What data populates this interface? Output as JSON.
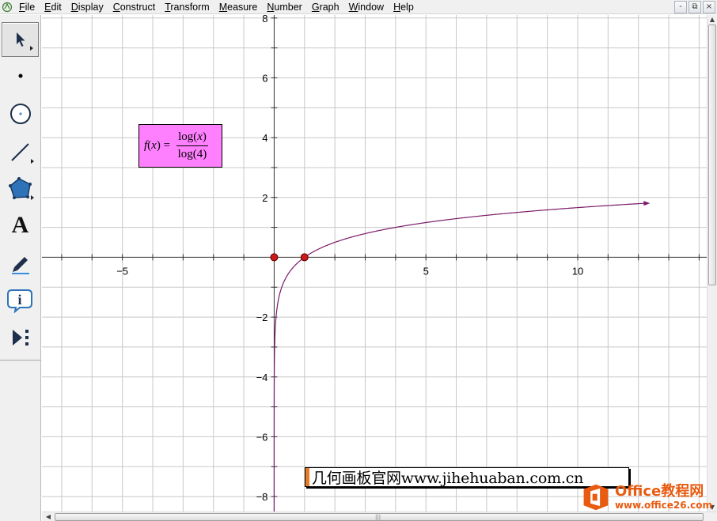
{
  "menubar": {
    "items": [
      {
        "accel": "F",
        "rest": "ile"
      },
      {
        "accel": "E",
        "rest": "dit"
      },
      {
        "accel": "D",
        "rest": "isplay"
      },
      {
        "accel": "C",
        "rest": "onstruct"
      },
      {
        "accel": "T",
        "rest": "ransform"
      },
      {
        "accel": "M",
        "rest": "easure"
      },
      {
        "accel": "N",
        "rest": "umber"
      },
      {
        "accel": "G",
        "rest": "raph"
      },
      {
        "accel": "W",
        "rest": "indow"
      },
      {
        "accel": "H",
        "rest": "elp"
      }
    ],
    "window_controls": [
      "-",
      "⧉",
      "×"
    ]
  },
  "toolbox": {
    "tools": [
      {
        "name": "selection-arrow-tool",
        "icon": "arrow-pointer-icon",
        "selected": true
      },
      {
        "name": "point-tool",
        "icon": "point-icon"
      },
      {
        "name": "compass-tool",
        "icon": "circle-icon"
      },
      {
        "name": "straightedge-tool",
        "icon": "segment-icon"
      },
      {
        "name": "polygon-tool",
        "icon": "polygon-icon"
      },
      {
        "name": "text-tool",
        "icon": "text-a-icon",
        "glyph": "A"
      },
      {
        "name": "marker-tool",
        "icon": "marker-pen-icon"
      },
      {
        "name": "information-tool",
        "icon": "info-icon",
        "glyph": "i"
      },
      {
        "name": "custom-tools",
        "icon": "custom-tools-icon"
      }
    ]
  },
  "graph": {
    "x_ticks": [
      "−5",
      "5",
      "10"
    ],
    "y_ticks": [
      "8",
      "6",
      "4",
      "2",
      "−2",
      "−4",
      "−6",
      "−8"
    ],
    "x_range": [
      -7.65,
      14.25
    ],
    "y_range": [
      -8.5,
      8.1
    ],
    "grid_step": 1,
    "grid": true,
    "curve_color": "#7a1a6a",
    "point_color": "#cc1a1a",
    "points": [
      {
        "x": 0,
        "y": 0
      },
      {
        "x": 1,
        "y": 0
      }
    ]
  },
  "function_label": {
    "lhs_fn": "f",
    "lhs_open": "(",
    "lhs_var": "x",
    "lhs_close": ") =",
    "numerator_pre": "log(",
    "numerator_var": "x",
    "numerator_post": ")",
    "denominator": "log(4)",
    "background": "#ff80ff"
  },
  "caption": {
    "text": "几何画板官网www.jihehuaban.com.cn"
  },
  "logo": {
    "brand": "Office教程网",
    "url": "www.office26.com",
    "color": "#e85b10"
  }
}
